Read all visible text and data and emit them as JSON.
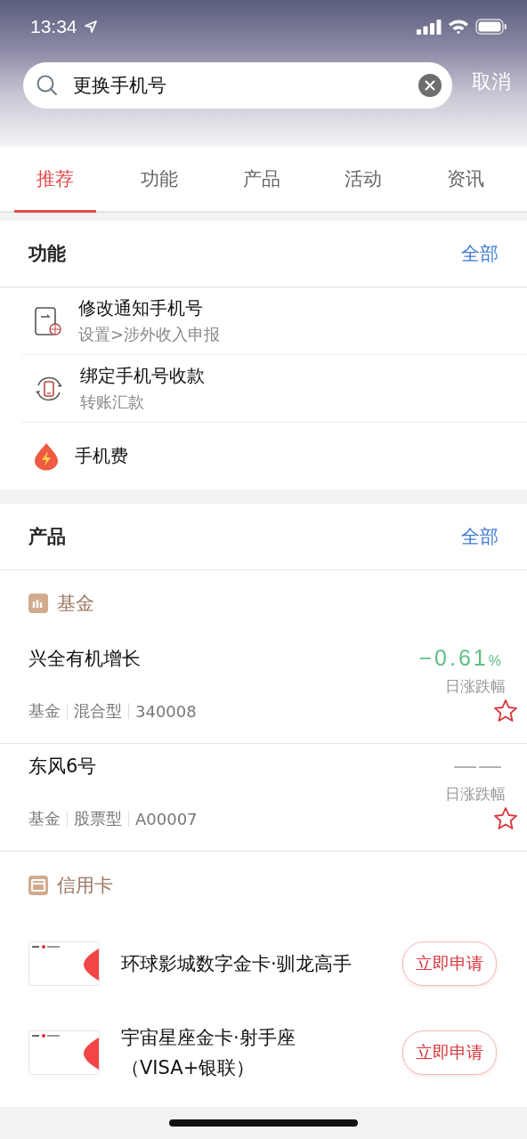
{
  "status_bar": {
    "time": "13:34"
  },
  "search": {
    "value": "更换手机号",
    "cancel": "取消"
  },
  "tabs": [
    {
      "label": "推荐",
      "selected": true
    },
    {
      "label": "功能",
      "selected": false
    },
    {
      "label": "产品",
      "selected": false
    },
    {
      "label": "活动",
      "selected": false
    },
    {
      "label": "资讯",
      "selected": false
    }
  ],
  "functions": {
    "title": "功能",
    "more": "全部",
    "items": [
      {
        "kind": "phone-globe",
        "title": "修改通知手机号",
        "subtitle": "设置>涉外收入申报"
      },
      {
        "kind": "phone-cycle",
        "title": "绑定手机号收款",
        "subtitle": "转账汇款"
      },
      {
        "kind": "bolt-drop",
        "title": "手机费"
      }
    ]
  },
  "products": {
    "title": "产品",
    "more": "全部",
    "funds": {
      "label": "基金",
      "items": [
        {
          "name": "兴全有机增长",
          "change": "−0.61",
          "unit": "%",
          "color": "#5fbf85",
          "change_label": "日涨跌幅",
          "tags": [
            "基金",
            "混合型",
            "340008"
          ],
          "favorite": false
        },
        {
          "name": "东风6号",
          "change": "——",
          "color": "#aaaaaa",
          "change_label": "日涨跌幅",
          "tags": [
            "基金",
            "股票型",
            "A00007"
          ],
          "favorite": false
        }
      ]
    },
    "cards": {
      "label": "信用卡",
      "items": [
        {
          "title_lines": [
            "环球影城数字金卡·驯龙高手"
          ],
          "action": "立即申请"
        },
        {
          "title_lines": [
            "宇宙星座金卡·射手座",
            "（VISA+银联）"
          ],
          "action": "立即申请"
        }
      ]
    }
  }
}
